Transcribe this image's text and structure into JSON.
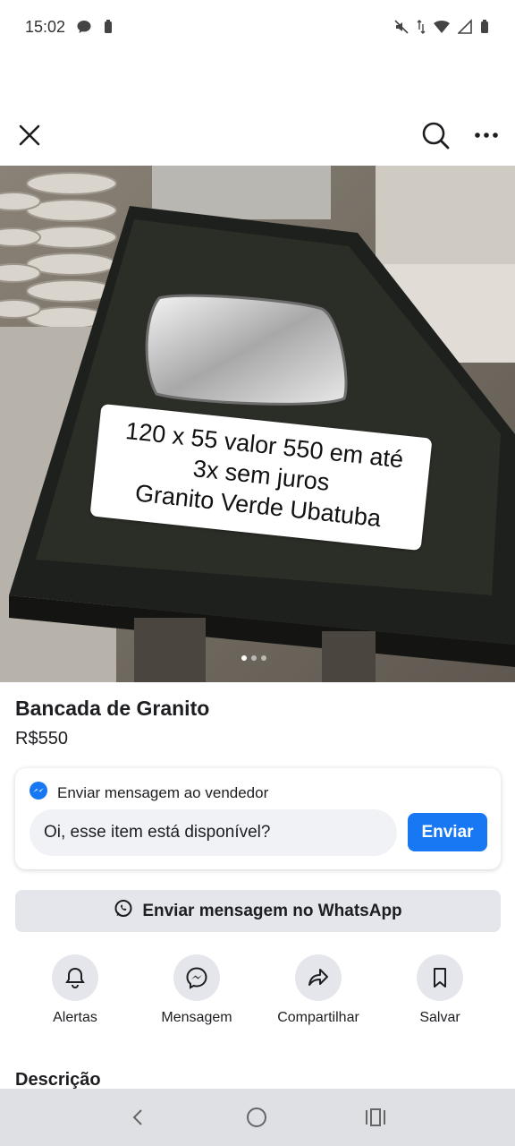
{
  "status_bar": {
    "time": "15:02"
  },
  "top_bar": {
    "close_icon": "close-icon",
    "search_icon": "search-icon",
    "more_icon": "more-icon"
  },
  "hero": {
    "caption_lines": [
      "120 x 55 valor 550 em até",
      "3x sem juros",
      "Granito Verde Ubatuba"
    ],
    "image_count": 3,
    "active_image": 1
  },
  "listing": {
    "title": "Bancada de Granito",
    "price": "R$550"
  },
  "message_card": {
    "heading": "Enviar mensagem ao vendedor",
    "input_value": "Oi, esse item está disponível?",
    "send_label": "Enviar"
  },
  "whatsapp": {
    "label": "Enviar mensagem no WhatsApp"
  },
  "actions": [
    {
      "label": "Alertas",
      "icon": "bell-icon"
    },
    {
      "label": "Mensagem",
      "icon": "messenger-icon"
    },
    {
      "label": "Compartilhar",
      "icon": "share-icon"
    },
    {
      "label": "Salvar",
      "icon": "bookmark-icon"
    }
  ],
  "description": {
    "heading": "Descrição"
  },
  "colors": {
    "accent": "#1877f2",
    "button_bg": "#e4e6eb",
    "input_bg": "#f0f2f5",
    "nav_bg": "#dfe0e4"
  }
}
